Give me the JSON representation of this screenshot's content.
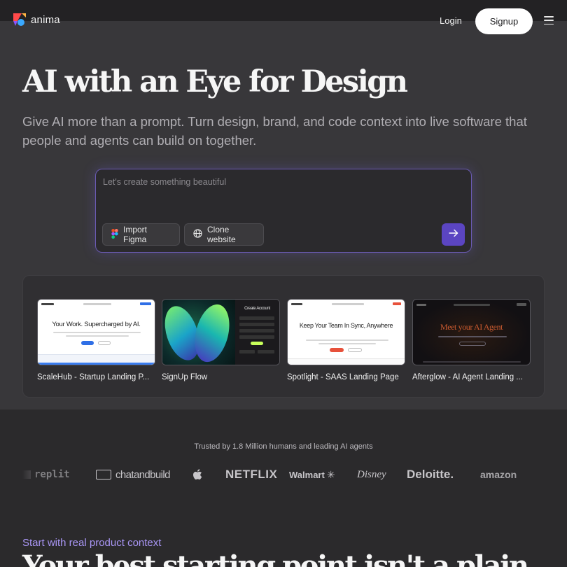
{
  "header": {
    "brand_name": "anima",
    "login_label": "Login",
    "signup_label": "Signup",
    "menu_icon": "hamburger-menu-icon"
  },
  "hero": {
    "title": "AI with an Eye for Design",
    "subtitle": "Give AI more than a prompt. Turn design, brand, and code context into live software that people and agents can build on together."
  },
  "prompt": {
    "placeholder": "Let's create something beautiful",
    "import_figma_label": "Import Figma",
    "clone_website_label": "Clone website",
    "send_icon": "arrow-right-icon"
  },
  "templates": [
    {
      "label": "ScaleHub - Startup Landing P...",
      "heading": "Your Work. Supercharged by AI."
    },
    {
      "label": "SignUp Flow",
      "heading": "Create Account"
    },
    {
      "label": "Spotlight - SAAS Landing Page",
      "heading": "Keep Your Team In Sync, Anywhere"
    },
    {
      "label": "Afterglow - AI Agent Landing ...",
      "heading": "Meet your AI Agent"
    }
  ],
  "trust": {
    "text": "Trusted by 1.8 Million humans and leading AI agents",
    "logos": [
      "replit",
      "chatandbuild",
      "apple",
      "NETFLIX",
      "Walmart",
      "Disney",
      "Deloitte.",
      "amazon"
    ]
  },
  "section": {
    "kicker": "Start with real product context",
    "title": "Your best starting point isn't a plain"
  },
  "colors": {
    "accent": "#5b45c2",
    "kicker": "#a996f5",
    "hero_bg": "#38373a",
    "page_bg": "#2b2a2c"
  }
}
